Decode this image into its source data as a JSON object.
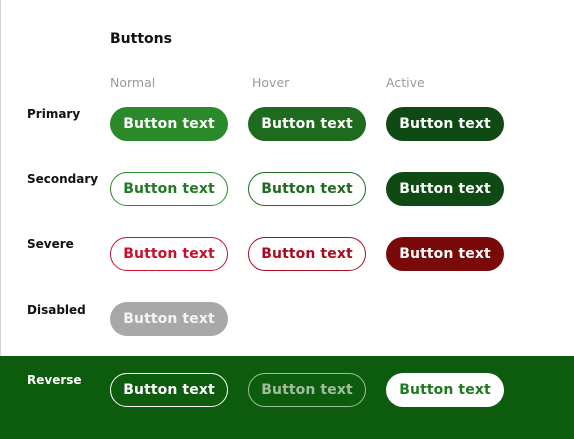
{
  "title": "Buttons",
  "columns": {
    "normal": "Normal",
    "hover": "Hover",
    "active": "Active"
  },
  "rows": {
    "primary": {
      "label": "Primary",
      "normal": "Button text",
      "hover": "Button text",
      "active": "Button text"
    },
    "secondary": {
      "label": "Secondary",
      "normal": "Button text",
      "hover": "Button text",
      "active": "Button text"
    },
    "severe": {
      "label": "Severe",
      "normal": "Button text",
      "hover": "Button text",
      "active": "Button text"
    },
    "disabled": {
      "label": "Disabled",
      "normal": "Button text"
    },
    "reverse": {
      "label": "Reverse",
      "normal": "Button text",
      "hover": "Button text",
      "active": "Button text"
    }
  },
  "colors": {
    "primary_normal": "#2a8a2a",
    "primary_hover": "#1e6b1e",
    "primary_active": "#0f4a14",
    "secondary_text": "#217a21",
    "severe": "#c8102e",
    "severe_active": "#7a0a0a",
    "disabled": "#a8a8a8",
    "reverse_band": "#0d5c0d"
  }
}
